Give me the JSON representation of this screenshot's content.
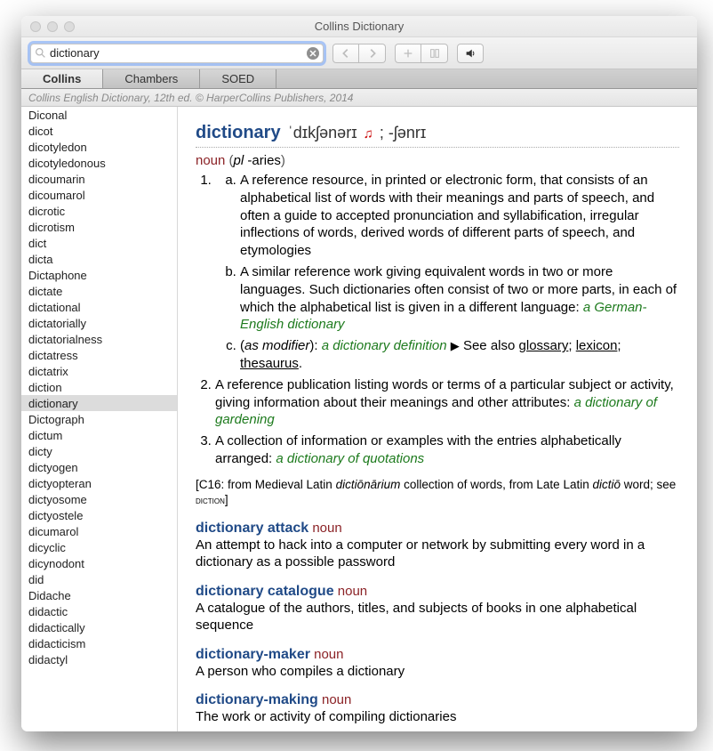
{
  "window": {
    "title": "Collins Dictionary"
  },
  "search": {
    "value": "dictionary",
    "placeholder": ""
  },
  "tabs": [
    {
      "label": "Collins",
      "active": true
    },
    {
      "label": "Chambers",
      "active": false
    },
    {
      "label": "SOED",
      "active": false
    }
  ],
  "sourceline": "Collins English Dictionary, 12th ed. © HarperCollins Publishers, 2014",
  "wordlist": [
    "Diconal",
    "dicot",
    "dicotyledon",
    "dicotyledonous",
    "dicoumarin",
    "dicoumarol",
    "dicrotic",
    "dicrotism",
    "dict",
    "dicta",
    "Dictaphone",
    "dictate",
    "dictational",
    "dictatorially",
    "dictatorialness",
    "dictatress",
    "dictatrix",
    "diction",
    "dictionary",
    "Dictograph",
    "dictum",
    "dicty",
    "dictyogen",
    "dictyopteran",
    "dictyosome",
    "dictyostele",
    "dicumarol",
    "dicyclic",
    "dicynodont",
    "did",
    "Didache",
    "didactic",
    "didactically",
    "didacticism",
    "didactyl"
  ],
  "selected_word": "dictionary",
  "entry": {
    "headword": "dictionary",
    "pron_pre": "ˈdɪkʃənərɪ ",
    "pron_post": " ; -ʃənrɪ",
    "pos": "noun",
    "plural_prefix": "pl",
    "plural": "-aries",
    "senses": {
      "s1a": "A reference resource, in printed or electronic form, that consists of an alphabetical list of words with their meanings and parts of speech, and often a guide to accepted pronunciation and syllabification, irregular inflections of words, derived words of different parts of speech, and etymologies",
      "s1b_text": "A similar reference work giving equivalent words in two or more languages. Such dictionaries often consist of two or more parts, in each of which the alphabetical list is given in a different language: ",
      "s1b_ex": "a German-English dictionary",
      "s1c_mod": "as modifier",
      "s1c_ex": "a dictionary definition",
      "s1c_seealso": " See also ",
      "s1c_xref1": "glossary",
      "s1c_xref2": "lexicon",
      "s1c_xref3": "thesaurus",
      "s2_text": "A reference publication listing words or terms of a particular subject or activity, giving information about their meanings and other attributes: ",
      "s2_ex": "a dictionary of gardening",
      "s3_text": "A collection of information or examples with the entries alphabetically arranged: ",
      "s3_ex": "a dictionary of quotations"
    },
    "etym_pre": "[C16: from Medieval Latin ",
    "etym_lat1": "dictiōnārium",
    "etym_mid": " collection of words, from Late Latin ",
    "etym_lat2": "dictiō",
    "etym_post1": " word; see ",
    "etym_sc": "diction",
    "etym_post2": "]"
  },
  "subentries": [
    {
      "hw": "dictionary attack",
      "pos": "noun",
      "def": "An attempt to hack into a computer or network by submitting every word in a dictionary as a possible password"
    },
    {
      "hw": "dictionary catalogue",
      "pos": "noun",
      "def": "A catalogue of the authors, titles, and subjects of books in one alphabetical sequence"
    },
    {
      "hw": "dictionary-maker",
      "pos": "noun",
      "def": "A person who compiles a dictionary"
    },
    {
      "hw": "dictionary-making",
      "pos": "noun",
      "def": "The work or activity of compiling dictionaries"
    }
  ]
}
